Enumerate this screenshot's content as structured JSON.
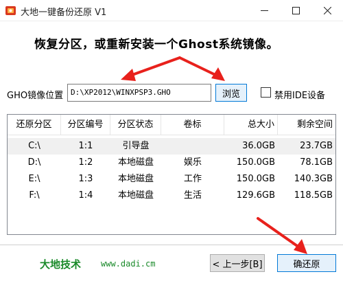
{
  "window": {
    "title": "大地一键备份还原 V1"
  },
  "headline": "恢复分区，或重新安装一个Ghost系统镜像。",
  "gho": {
    "label": "GHO镜像位置",
    "path": "D:\\XP2012\\WINXPSP3.GHO",
    "browse_label": "浏览",
    "ide_label": "禁用IDE设备",
    "ide_checked": false
  },
  "table": {
    "columns": [
      "还原分区",
      "分区编号",
      "分区状态",
      "卷标",
      "总大小",
      "剩余空间"
    ],
    "rows": [
      {
        "drive": "C:\\",
        "number": "1:1",
        "status": "引导盘",
        "volume": "",
        "total": "36.0GB",
        "free": "23.7GB",
        "selected": true
      },
      {
        "drive": "D:\\",
        "number": "1:2",
        "status": "本地磁盘",
        "volume": "娱乐",
        "total": "150.0GB",
        "free": "78.1GB",
        "selected": false
      },
      {
        "drive": "E:\\",
        "number": "1:3",
        "status": "本地磁盘",
        "volume": "工作",
        "total": "150.0GB",
        "free": "140.3GB",
        "selected": false
      },
      {
        "drive": "F:\\",
        "number": "1:4",
        "status": "本地磁盘",
        "volume": "生活",
        "total": "129.6GB",
        "free": "118.5GB",
        "selected": false
      }
    ]
  },
  "footer": {
    "brand": "大地技术",
    "url": "www.dadi.cm",
    "prev_label": "< 上一步[B]",
    "restore_label": "确还原"
  },
  "colors": {
    "annotation_red": "#e8211c",
    "brand_green": "#1a8a2a",
    "accent_blue": "#0078d7"
  }
}
